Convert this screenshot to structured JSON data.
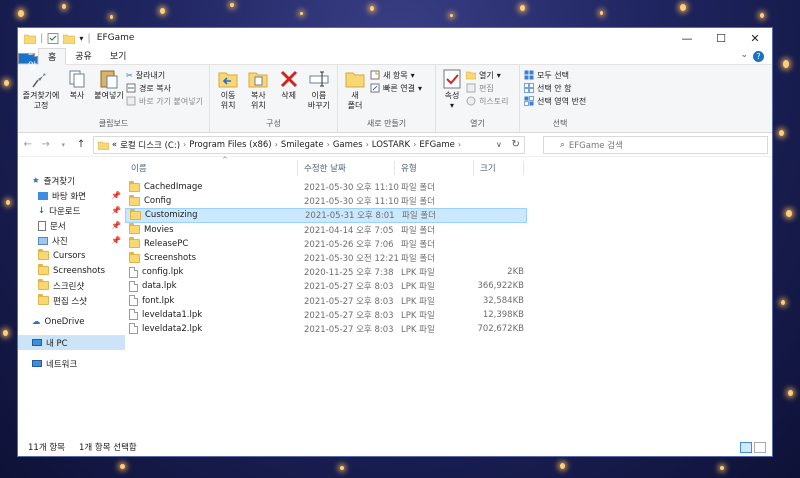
{
  "window": {
    "title": "EFGame"
  },
  "window_controls": {
    "minimize": "—",
    "maximize": "☐",
    "close": "✕"
  },
  "tabs": [
    {
      "label": "파일"
    },
    {
      "label": "홈"
    },
    {
      "label": "공유"
    },
    {
      "label": "보기"
    }
  ],
  "ribbon": {
    "clipboard": {
      "label": "클립보드",
      "pin": "즐겨찾기에\n고정",
      "copy": "복사",
      "paste": "붙여넣기",
      "cut": "잘라내기",
      "copy_path": "경로 복사",
      "paste_shortcut": "바로 가기 붙여넣기"
    },
    "organize": {
      "label": "구성",
      "move_to": "이동\n위치",
      "copy_to": "복사\n위치",
      "delete": "삭제",
      "rename": "이름\n바꾸기"
    },
    "new": {
      "label": "새로 만들기",
      "new_folder": "새\n폴더",
      "new_item": "새 항목",
      "easy_access": "빠른 연결"
    },
    "open": {
      "label": "열기",
      "properties": "속성",
      "open": "열기",
      "edit": "편집",
      "history": "히스토리"
    },
    "select": {
      "label": "선택",
      "select_all": "모두 선택",
      "select_none": "선택 안 함",
      "invert": "선택 영역 반전"
    }
  },
  "address": {
    "prefix": "«",
    "crumbs": [
      "로컬 디스크 (C:)",
      "Program Files (x86)",
      "Smilegate",
      "Games",
      "LOSTARK",
      "EFGame"
    ],
    "search_placeholder": "EFGame 검색"
  },
  "nav": {
    "quick_access": "즐겨찾기",
    "items": [
      {
        "label": "바탕 화면",
        "icon": "desktop-icon",
        "pinned": true
      },
      {
        "label": "다운로드",
        "icon": "download-icon",
        "pinned": true
      },
      {
        "label": "문서",
        "icon": "document-icon",
        "pinned": true
      },
      {
        "label": "사진",
        "icon": "picture-icon",
        "pinned": true
      },
      {
        "label": "Cursors",
        "icon": "folder-icon",
        "pinned": false
      },
      {
        "label": "Screenshots",
        "icon": "folder-icon",
        "pinned": false
      },
      {
        "label": "스크린샷",
        "icon": "folder-icon",
        "pinned": false
      },
      {
        "label": "편집 스샷",
        "icon": "folder-icon",
        "pinned": false
      }
    ],
    "onedrive": "OneDrive",
    "this_pc": "내 PC",
    "network": "네트워크"
  },
  "columns": {
    "name": "이름",
    "date": "수정한 날짜",
    "type": "유형",
    "size": "크기"
  },
  "files": [
    {
      "name": "CachedImage",
      "date": "2021-05-30 오후 11:10",
      "type": "파일 폴더",
      "size": "",
      "kind": "folder"
    },
    {
      "name": "Config",
      "date": "2021-05-30 오후 11:10",
      "type": "파일 폴더",
      "size": "",
      "kind": "folder"
    },
    {
      "name": "Customizing",
      "date": "2021-05-31 오후 8:01",
      "type": "파일 폴더",
      "size": "",
      "kind": "folder",
      "selected": true
    },
    {
      "name": "Movies",
      "date": "2021-04-14 오후 7:05",
      "type": "파일 폴더",
      "size": "",
      "kind": "folder"
    },
    {
      "name": "ReleasePC",
      "date": "2021-05-26 오후 7:06",
      "type": "파일 폴더",
      "size": "",
      "kind": "folder"
    },
    {
      "name": "Screenshots",
      "date": "2021-05-30 오전 12:21",
      "type": "파일 폴더",
      "size": "",
      "kind": "folder"
    },
    {
      "name": "config.lpk",
      "date": "2020-11-25 오후 7:38",
      "type": "LPK 파일",
      "size": "2KB",
      "kind": "file"
    },
    {
      "name": "data.lpk",
      "date": "2021-05-27 오후 8:03",
      "type": "LPK 파일",
      "size": "366,922KB",
      "kind": "file"
    },
    {
      "name": "font.lpk",
      "date": "2021-05-27 오후 8:03",
      "type": "LPK 파일",
      "size": "32,584KB",
      "kind": "file"
    },
    {
      "name": "leveldata1.lpk",
      "date": "2021-05-27 오후 8:03",
      "type": "LPK 파일",
      "size": "12,398KB",
      "kind": "file"
    },
    {
      "name": "leveldata2.lpk",
      "date": "2021-05-27 오후 8:03",
      "type": "LPK 파일",
      "size": "702,672KB",
      "kind": "file"
    }
  ],
  "status": {
    "count": "11개 항목",
    "selected": "1개 항목 선택함"
  },
  "colors": {
    "accent": "#1a73c6",
    "selection": "#cce8ff",
    "folder": "#f8d775"
  }
}
